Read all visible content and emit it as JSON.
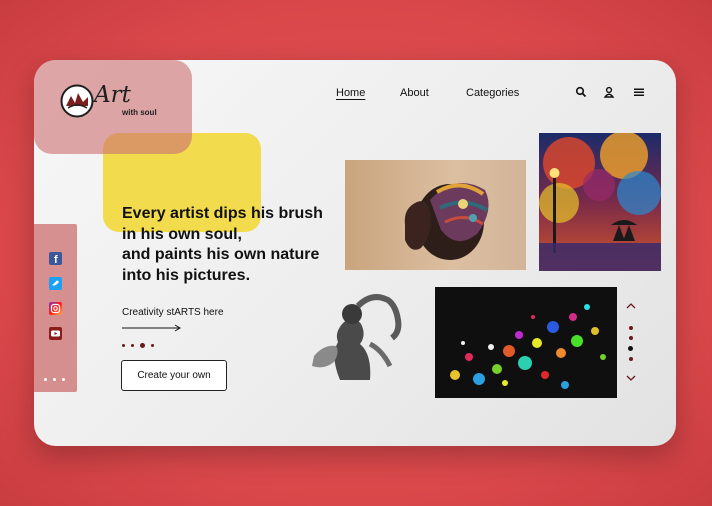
{
  "brand": {
    "title": "Art",
    "subtitle": "with soul"
  },
  "nav": {
    "items": [
      {
        "label": "Home",
        "active": true
      },
      {
        "label": "About",
        "active": false
      },
      {
        "label": "Categories",
        "active": false
      }
    ]
  },
  "header_icons": [
    "search-icon",
    "user-icon",
    "menu-icon"
  ],
  "hero": {
    "headline_lines": [
      "Every artist dips his brush",
      "in his own soul,",
      "and paints his own nature",
      "into his pictures."
    ],
    "tagline": "Creativity stARTS here",
    "button_label": "Create your own"
  },
  "social": [
    "facebook-icon",
    "twitter-icon",
    "instagram-icon",
    "youtube-icon"
  ],
  "gallery": [
    "portrait-headwrap-painting",
    "autumn-street-painting",
    "woman-sketch-drawing",
    "colorful-dots-painting"
  ],
  "colors": {
    "background": "#d9474a",
    "accent": "#6a1a1a",
    "logo_panel": "#cd7373",
    "highlight": "#f2d628"
  }
}
